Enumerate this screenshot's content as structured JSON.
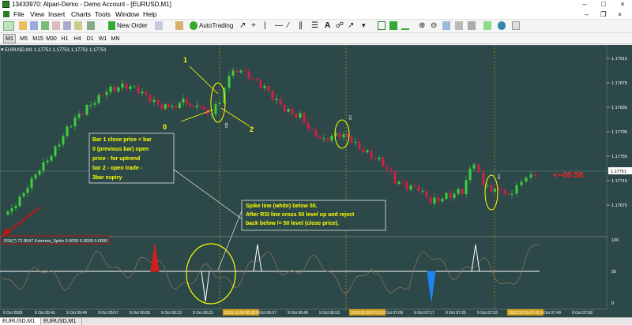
{
  "window": {
    "title": "13433970: Alpari-Demo - Demo Account - [EURUSD,M1]"
  },
  "menu": [
    "File",
    "View",
    "Insert",
    "Charts",
    "Tools",
    "Window",
    "Help"
  ],
  "toolbar": {
    "new_order": "New Order",
    "autotrading": "AutoTrading"
  },
  "timeframes": [
    "M1",
    "M5",
    "M15",
    "M30",
    "H1",
    "H4",
    "D1",
    "W1",
    "MN"
  ],
  "chart": {
    "symbol_info": "EURUSD,M1  1.17751 1.17751 1.17751 1.17751",
    "price_ticks": [
      "1.17915",
      "1.17875",
      "1.17835",
      "1.17795",
      "1.17755",
      "1.17715",
      "1.17675"
    ],
    "price_current": "1.17751",
    "countdown": "<--00:58",
    "time_ticks": [
      "9 Oct 2020",
      "9 Oct 05:41",
      "9 Oct 05:49",
      "9 Oct 05:57",
      "9 Oct 06:05",
      "9 Oct 06:13",
      "9 Oct 06:21",
      "2020.10.09 06:29",
      "9 Oct 06:37",
      "9 Oct 06:45",
      "9 Oct 06:53",
      "2020.10.09 07:01",
      "9 Oct 07:09",
      "9 Oct 07:17",
      "9 Oct 07:25",
      "9 Oct 07:33",
      "2020.10.09 07:41",
      "9 Oct 07:49",
      "9 Oct 07:58"
    ],
    "annotations": {
      "n1": "1",
      "n0": "0",
      "n2": "2"
    },
    "note1": [
      "Bar 1 close price < bar",
      "0 (previous bar) open",
      "price - for uptrend",
      "bar 2 - open trade -",
      "3bar expiry"
    ],
    "note2": [
      "Spike line (white) below 50.",
      "After RSI line cross 50 level up and reject",
      "back below /= 50 level (close price)."
    ],
    "indicator_label": "RSI(7) 72.8547  Extreme_Spike 0.0000 0.0000 0.0000",
    "rsi_ticks": [
      "100",
      "50",
      "0"
    ],
    "colors": {
      "background": "#2c4848",
      "bull": "#3cd23c",
      "bear": "#d21e46",
      "annot": "#ffff00",
      "note_bg": "#2c4848",
      "spike_red": "#d21e1e",
      "spike_blue": "#1e82f0"
    }
  },
  "tabs": [
    "EURUSD,M1",
    "EURUSD,M1"
  ]
}
